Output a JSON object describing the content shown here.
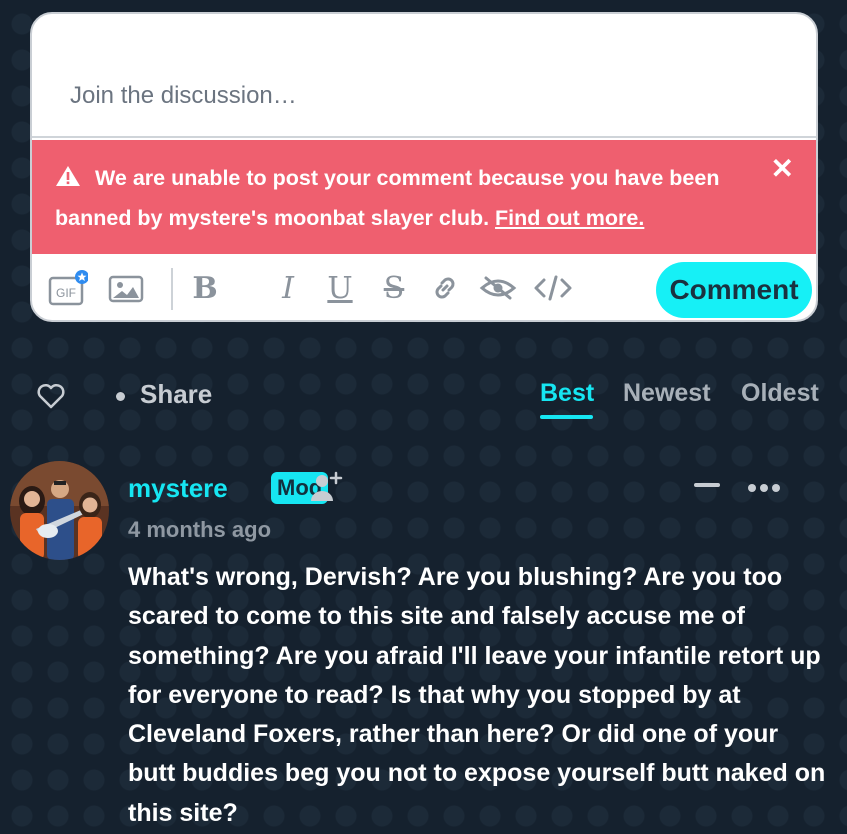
{
  "composer": {
    "placeholder": "Join the discussion…",
    "alert_text": "We are unable to post your comment because you have been banned by mystere's moonbat slayer club.",
    "alert_link": "Find out more.",
    "close_glyph": "✕",
    "gif_label": "GIF",
    "toolbar": {
      "bold": "B",
      "italic": "I",
      "underline": "U",
      "strike": "S"
    },
    "comment_button": "Comment"
  },
  "actions": {
    "share_label": "Share",
    "sort_tabs": [
      "Best",
      "Newest",
      "Oldest"
    ],
    "active_sort": "Best"
  },
  "comment": {
    "author": "mystere",
    "badge": "Mod",
    "timestamp": "4 months ago",
    "body": "What's wrong, Dervish? Are you blushing? Are you too scared to come to this site and falsely accuse me of something? Are you afraid I'll leave your infantile retort up for everyone to read? Is that why you stopped by at Cleveland Foxers, rather than here? Or did one of your butt buddies beg you not to expose yourself butt naked on this site?"
  },
  "colors": {
    "background": "#15212e",
    "accent": "#16e6f2",
    "alert": "#ef5f6f"
  }
}
